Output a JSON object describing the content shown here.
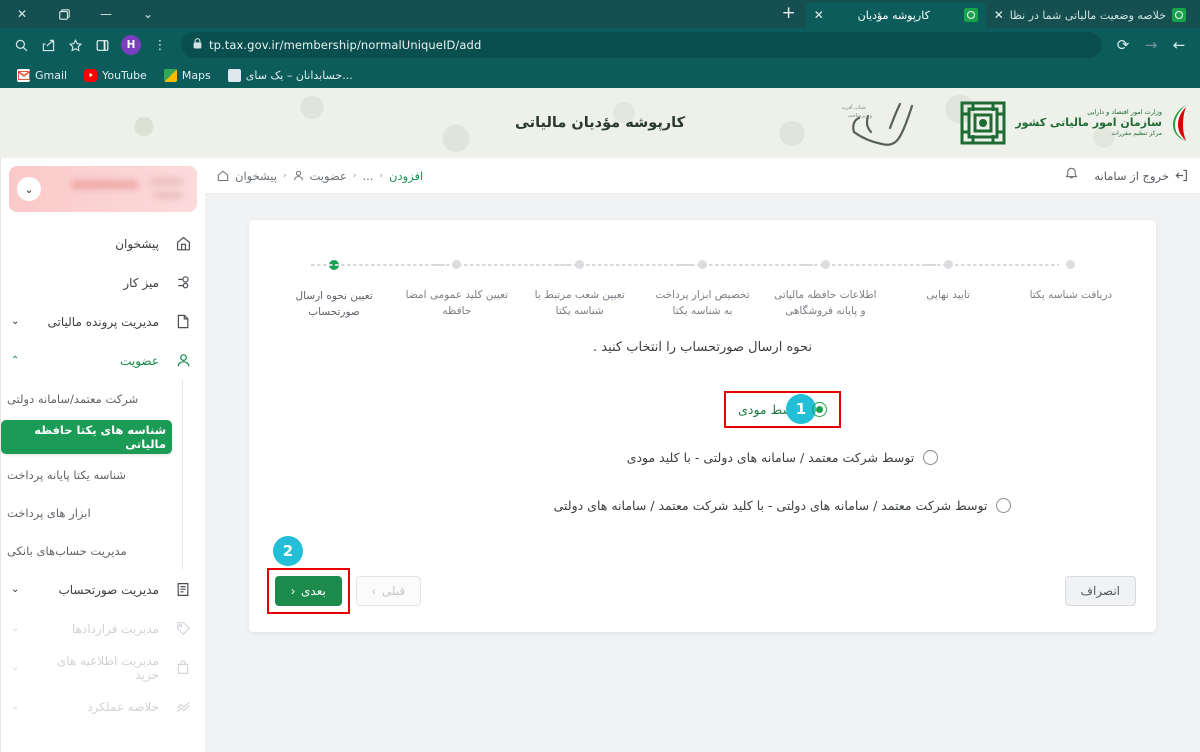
{
  "browser": {
    "tabs": [
      {
        "title": "خلاصه وضعیت مالیاتی شما در نظا",
        "favicon": "tax-logo-icon",
        "active": false,
        "close": "✕"
      },
      {
        "title": "کارپوشه مؤدیان",
        "favicon": "tax-logo-icon",
        "active": true,
        "close": "✕"
      }
    ],
    "new_tab_label": "+",
    "window_controls": {
      "tab_search": "⌄",
      "minimize": "—",
      "maximize": "❐",
      "close": "✕"
    },
    "nav": {
      "back": "←",
      "forward": "→",
      "reload": "⟳"
    },
    "address": {
      "lock": "🔒",
      "url": "tp.tax.gov.ir/membership/normalUniqueID/add"
    },
    "toolbar_right": {
      "search": "search-icon",
      "share": "share-icon",
      "bookmark": "star-icon",
      "side_panel": "side-panel-icon",
      "profile_initial": "H",
      "menu": "⋮"
    },
    "bookmarks": [
      {
        "label": "Gmail",
        "icon": "gmail-icon"
      },
      {
        "label": "YouTube",
        "icon": "youtube-icon"
      },
      {
        "label": "Maps",
        "icon": "maps-icon"
      },
      {
        "label": "حسابدانان – یک سای...",
        "icon": "accountants-icon"
      }
    ]
  },
  "site_header": {
    "title": "کارپوشه مؤدیان مالیاتی",
    "org": {
      "line1": "وزارت امور اقتصاد و دارایی",
      "line2": "سازمان امور مالیاتی کشور",
      "line3": "مرکز تنظیم مقررات"
    },
    "campaign_logo": "tolid-calligraphy-logo"
  },
  "topbar": {
    "breadcrumb": [
      {
        "label": "پیشخوان",
        "icon": "home-icon"
      },
      {
        "label": "عضویت",
        "icon": "person-icon"
      },
      {
        "label": "...",
        "icon": ""
      },
      {
        "label": "افزودن",
        "icon": ""
      }
    ],
    "separator": "‹",
    "bell": "bell-icon",
    "logout_label": "خروج از سامانه",
    "logout_icon": "logout-icon"
  },
  "sidebar": {
    "user_card": {
      "chevron": "⌄"
    },
    "items": [
      {
        "label": "پیشخوان",
        "icon": "home-icon",
        "arrow": "",
        "state": "normal"
      },
      {
        "label": "میز کار",
        "icon": "workdesk-icon",
        "arrow": "",
        "state": "normal"
      },
      {
        "label": "مدیریت پرونده مالیاتی",
        "icon": "file-icon",
        "arrow": "⌄",
        "state": "normal"
      },
      {
        "label": "عضویت",
        "icon": "person-icon",
        "arrow": "⌃",
        "state": "open"
      }
    ],
    "submenu": [
      {
        "label": "شرکت معتمد/سامانه دولتی",
        "active": false
      },
      {
        "label": "شناسه های یکتا حافظه مالیاتی",
        "active": true
      },
      {
        "label": "شناسه یکتا پایانه پرداخت",
        "active": false
      },
      {
        "label": "ابزار های پرداخت",
        "active": false
      },
      {
        "label": "مدیریت حساب‌های بانکی",
        "active": false
      }
    ],
    "items_after": [
      {
        "label": "مدیریت صورتحساب",
        "icon": "invoice-icon",
        "arrow": "⌄",
        "state": "normal"
      },
      {
        "label": "مدیریت قراردادها",
        "icon": "contract-icon",
        "arrow": "⌄",
        "state": "dim"
      },
      {
        "label": "مدیریت اطلاعیه های خرید",
        "icon": "bag-icon",
        "arrow": "⌄",
        "state": "dim"
      },
      {
        "label": "خلاصه عملکرد",
        "icon": "chart-icon",
        "arrow": "⌄",
        "state": "dim"
      }
    ]
  },
  "wizard": {
    "steps": [
      {
        "label": "تعیین نحوه ارسال صورتحساب",
        "done": true
      },
      {
        "label": "تعیین کلید عمومی امضا حافظه",
        "done": false
      },
      {
        "label": "تعیین شعب مرتبط با شناسه یکتا",
        "done": false
      },
      {
        "label": "تخصیص ابزار پرداخت به شناسه یکتا",
        "done": false
      },
      {
        "label": "اطلاعات حافظه مالیاتی و پایانه فروشگاهی",
        "done": false
      },
      {
        "label": "تایید نهایی",
        "done": false
      },
      {
        "label": "دریافت شناسه یکتا",
        "done": false
      }
    ],
    "question": "نحوه ارسال صورتحساب را انتخاب کنید .",
    "options": [
      {
        "label": "توسط مودی",
        "selected": true,
        "annotated": true,
        "badge": "1"
      },
      {
        "label": "توسط شرکت معتمد / سامانه های دولتی - با کلید مودی",
        "selected": false,
        "annotated": false,
        "badge": ""
      },
      {
        "label": "توسط شرکت معتمد / سامانه های دولتی - با کلید شرکت معتمد / سامانه های دولتی",
        "selected": false,
        "annotated": false,
        "badge": ""
      }
    ],
    "buttons": {
      "next": "بعدی",
      "next_chevron": "‹",
      "prev": "قبلی",
      "prev_chevron": "›",
      "cancel": "انصراف",
      "next_badge": "2"
    }
  },
  "colors": {
    "brand_green": "#1b8a4b",
    "active_green": "#1b9b55",
    "annotation_red": "#e80000",
    "badge_cyan": "#22bfd6",
    "browser_teal": "#0d5c5c"
  }
}
